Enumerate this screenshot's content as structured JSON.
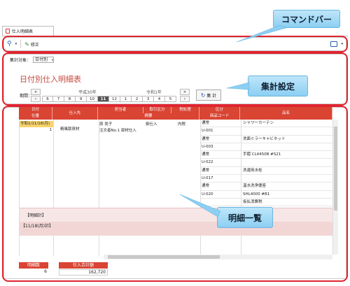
{
  "tab": {
    "label": "仕入明細表"
  },
  "toolbar": {
    "edit_label": "修正"
  },
  "callouts": {
    "commandbar": "コマンドバー",
    "settings": "集計設定",
    "list": "明細一覧"
  },
  "settings": {
    "target_label": "集計対象：",
    "target_value": "日付別",
    "title": "日付別仕入明細表",
    "period_label": "期間：",
    "era_left": "平成30年",
    "era_right": "令和1年",
    "months": [
      "6",
      "7",
      "8",
      "9",
      "10",
      "11",
      "12",
      "1",
      "2",
      "3",
      "4",
      "5"
    ],
    "selected_month": "11",
    "aggregate_label": "集 計"
  },
  "table": {
    "headers_row1": [
      "日付",
      "仕入先",
      "担当者",
      "取引区分",
      "税処理",
      "区分",
      "品名"
    ],
    "headers_row2": [
      "仕番",
      "",
      "",
      "摘要",
      "",
      "商品コード",
      ""
    ],
    "date": "令和1/11/18(月)",
    "slip_no": "1",
    "supplier": "精風版資材",
    "staff": "原 尚子",
    "deal": "掛仕入",
    "tax": "内税",
    "memo": "注文者No.1 部材仕入",
    "lines": [
      {
        "kubun": "通常",
        "name": "シャワーカーテン"
      },
      {
        "kubun": "U-001",
        "name": ""
      },
      {
        "kubun": "通常",
        "name": "洗面ミラーキャビネット"
      },
      {
        "kubun": "U-003",
        "name": ""
      },
      {
        "kubun": "通常",
        "name": "手摺 CL4450B #S21"
      },
      {
        "kubun": "U-022",
        "name": ""
      },
      {
        "kubun": "通常",
        "name": "洗濯用水栓"
      },
      {
        "kubun": "U-017",
        "name": ""
      },
      {
        "kubun": "通常",
        "name": "温水洗浄便座"
      },
      {
        "kubun": "U-020",
        "name": "SHL4000 #B1"
      },
      {
        "kubun": "",
        "name": "仮払消費税"
      }
    ],
    "subtotal_detail": "【明細計】",
    "subtotal_date": "【11/18(月)計】"
  },
  "footer": {
    "count_label": "明細数",
    "count_value": "6",
    "total_label": "仕入合計額",
    "total_value": "162,720"
  },
  "colors": {
    "accent": "#d94433",
    "highlight": "#e0242f",
    "callout": "#8ccff3"
  }
}
